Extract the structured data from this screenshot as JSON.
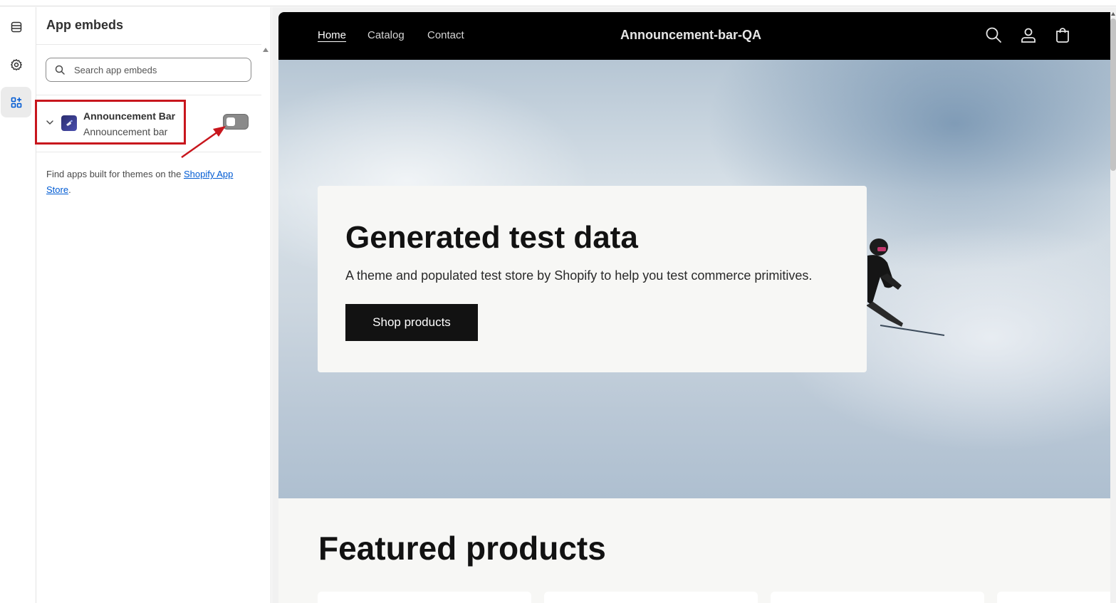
{
  "sidebar": {
    "title": "App embeds",
    "search_placeholder": "Search app embeds",
    "embeds": [
      {
        "name": "Announcement Bar",
        "subtitle": "Announcement bar",
        "enabled": false
      }
    ],
    "footer_text": "Find apps built for themes on the ",
    "footer_link": "Shopify App Store",
    "footer_end": "."
  },
  "rail": {
    "items": [
      "sections-icon",
      "settings-icon",
      "apps-icon"
    ],
    "active": "apps-icon"
  },
  "store": {
    "nav": [
      "Home",
      "Catalog",
      "Contact"
    ],
    "active_nav": "Home",
    "name": "Announcement-bar-QA",
    "hero": {
      "title": "Generated test data",
      "subtitle": "A theme and populated test store by Shopify to help you test commerce primitives.",
      "button": "Shop products"
    },
    "featured_title": "Featured products"
  },
  "colors": {
    "highlight": "#c8161d",
    "link": "#005bd3",
    "header_bg": "#000000"
  }
}
